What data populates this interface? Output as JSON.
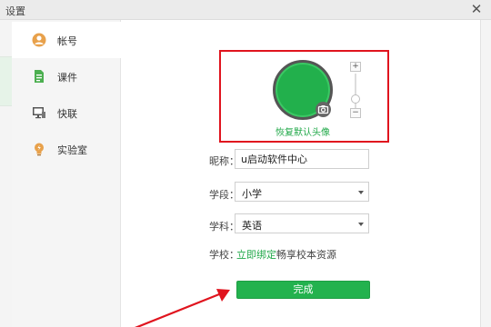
{
  "window": {
    "title": "设置",
    "close_symbol": "✕"
  },
  "sidebar": {
    "items": [
      {
        "label": "帐号",
        "icon": "user-icon",
        "active": true
      },
      {
        "label": "课件",
        "icon": "document-icon",
        "active": false
      },
      {
        "label": "快联",
        "icon": "monitor-icon",
        "active": false
      },
      {
        "label": "实验室",
        "icon": "bulb-icon",
        "active": false
      }
    ]
  },
  "avatar": {
    "restore_label": "恢复默认头像",
    "zoom_plus": "+",
    "zoom_minus": "−",
    "camera_icon": "camera-icon",
    "color": "#22b04c"
  },
  "form": {
    "nickname": {
      "label": "昵称：",
      "value": "u启动软件中心"
    },
    "stage": {
      "label": "学段：",
      "value": "小学"
    },
    "subject": {
      "label": "学科：",
      "value": "英语"
    },
    "school": {
      "label": "学校：",
      "bind_link": "立即绑定",
      "bind_text": "畅享校本资源"
    },
    "done_label": "完成"
  },
  "colors": {
    "accent": "#23b24e",
    "annotation": "#e0141e"
  }
}
